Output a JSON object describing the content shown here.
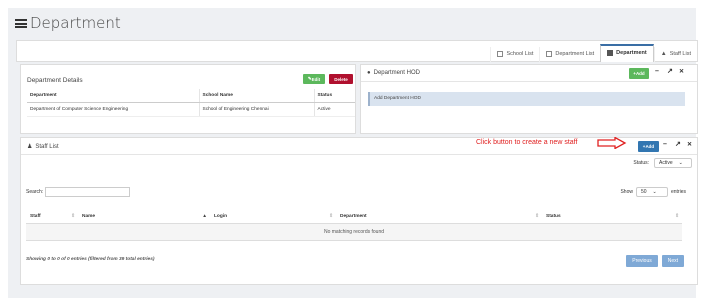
{
  "page": {
    "title": "Department"
  },
  "tabs": [
    {
      "label": "School List",
      "icon": "school-icon",
      "active": false
    },
    {
      "label": "Department List",
      "icon": "list-icon",
      "active": false
    },
    {
      "label": "Department",
      "icon": "building-icon",
      "active": true
    },
    {
      "label": "Staff List",
      "icon": "user-icon",
      "active": false
    }
  ],
  "dept_details": {
    "title": "Department Details",
    "edit_label": "Edit",
    "delete_label": "Delete",
    "columns": [
      "Department",
      "School Name",
      "Status"
    ],
    "rows": [
      [
        "Department of Computer Science Engineering",
        "School of Engineering Chennai",
        "Active"
      ]
    ]
  },
  "hod": {
    "title": "Department HOD",
    "add_label": "Add",
    "add_hod_text": "Add Department HOD"
  },
  "staff": {
    "title": "Staff List",
    "add_label": "Add",
    "annotation": "Click button to create a new staff",
    "status_label": "Status:",
    "status_value": "Active",
    "search_label": "Search:",
    "show_label": "Show",
    "show_value": "50",
    "entries_label": "entries",
    "columns": [
      "Staff",
      "Name",
      "Login",
      "Department",
      "Status"
    ],
    "empty_text": "No matching records found",
    "info": "Showing 0 to 0 of 0 entries (filtered from 39 total entries)",
    "prev_label": "Previous",
    "next_label": "Next"
  },
  "colors": {
    "green": "#5cb85c",
    "red": "#b0102e",
    "blue": "#3276b1",
    "annotation": "#e02020"
  }
}
